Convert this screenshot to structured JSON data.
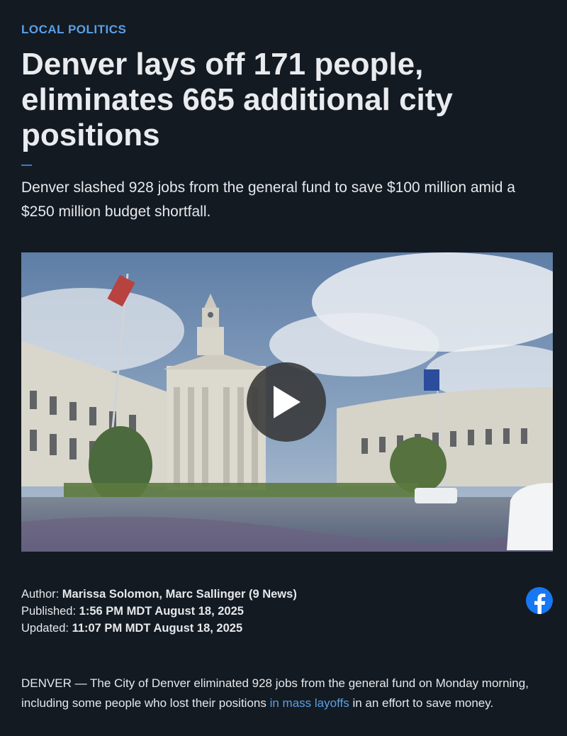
{
  "article": {
    "category": "LOCAL POLITICS",
    "headline": "Denver lays off 171 people, eliminates 665 additional city positions",
    "dek": "Denver slashed 928 jobs from the general fund to save $100 million amid a $250 million budget shortfall.",
    "author_label": "Author:",
    "author": "Marissa Solomon, Marc Sallinger (9 News)",
    "published_label": "Published:",
    "published": "1:56 PM MDT August 18, 2025",
    "updated_label": "Updated:",
    "updated": "11:07 PM MDT August 18, 2025",
    "body_before": "DENVER — The City of Denver eliminated 928 jobs from the general fund on Monday morning, including some people who lost their positions ",
    "body_link": "in mass layoffs",
    "body_after": " in an effort to save money."
  },
  "video": {
    "play_icon": "play-icon"
  },
  "share": {
    "facebook_icon": "facebook-icon",
    "brand_color": "#1877f2"
  },
  "colors": {
    "background": "#131a22",
    "accent": "#5aa0e6"
  }
}
